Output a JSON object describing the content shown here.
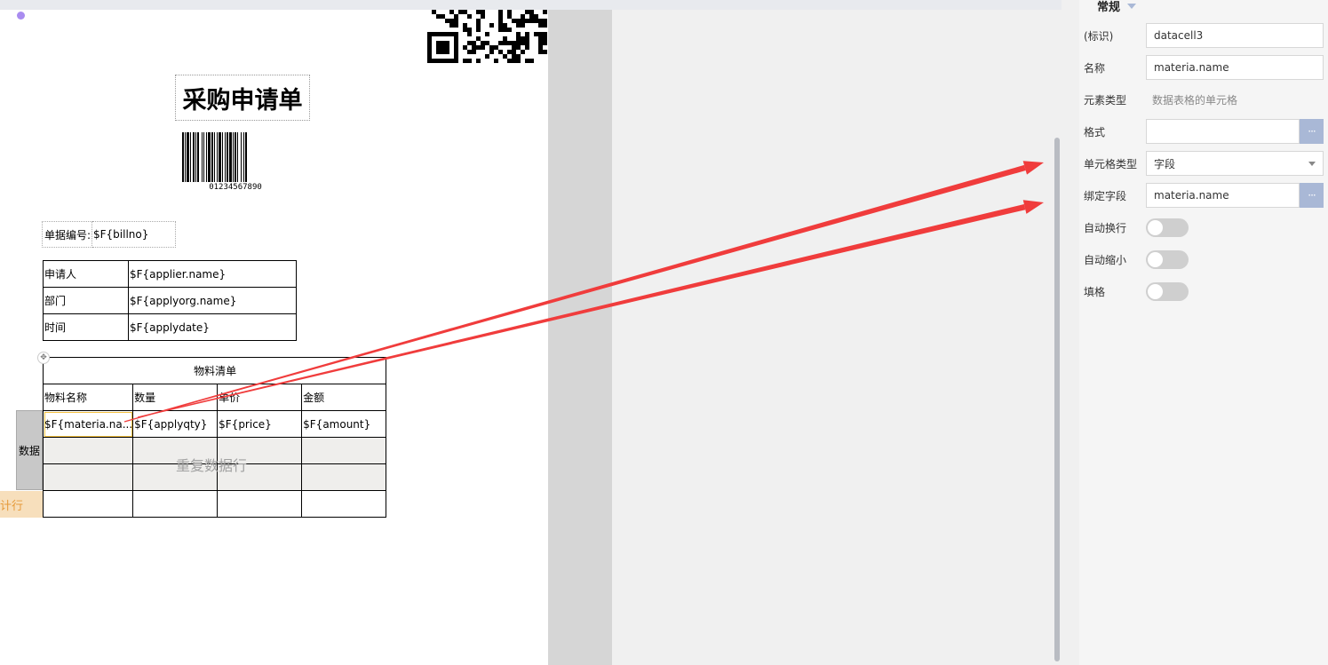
{
  "report": {
    "title": "采购申请单",
    "barcode_text": "01234567890",
    "billno_label": "单据编号:",
    "billno_value": "$F{billno}",
    "info_rows": [
      {
        "label": "申请人",
        "value": "$F{applier.name}"
      },
      {
        "label": "部门",
        "value": "$F{applyorg.name}"
      },
      {
        "label": "时间",
        "value": "$F{applydate}"
      }
    ],
    "material_table": {
      "title": "物料清单",
      "headers": [
        "物料名称",
        "数量",
        "单价",
        "金额"
      ],
      "data_row": [
        "$F{materia.na...",
        "$F{applyqty}",
        "$F{price}",
        "$F{amount}"
      ],
      "repeat_label": "重复数据行"
    },
    "side_data_label": "数据",
    "side_total_label": "计行"
  },
  "panel": {
    "header": "常规",
    "fields": {
      "id_label": "(标识)",
      "id_value": "datacell3",
      "name_label": "名称",
      "name_value": "materia.name",
      "element_type_label": "元素类型",
      "element_type_value": "数据表格的单元格",
      "format_label": "格式",
      "format_value": "",
      "format_button": "···",
      "cell_type_label": "单元格类型",
      "cell_type_value": "字段",
      "bind_field_label": "绑定字段",
      "bind_field_value": "materia.name",
      "bind_field_button": "···",
      "auto_wrap_label": "自动换行",
      "auto_shrink_label": "自动缩小",
      "fill_grid_label": "填格"
    },
    "toggles": {
      "auto_wrap": false,
      "auto_shrink": false,
      "fill_grid": false
    }
  },
  "colors": {
    "arrow": "#f03c3c",
    "selected_cell": "#f5c242",
    "button": "#a9b8d6"
  }
}
